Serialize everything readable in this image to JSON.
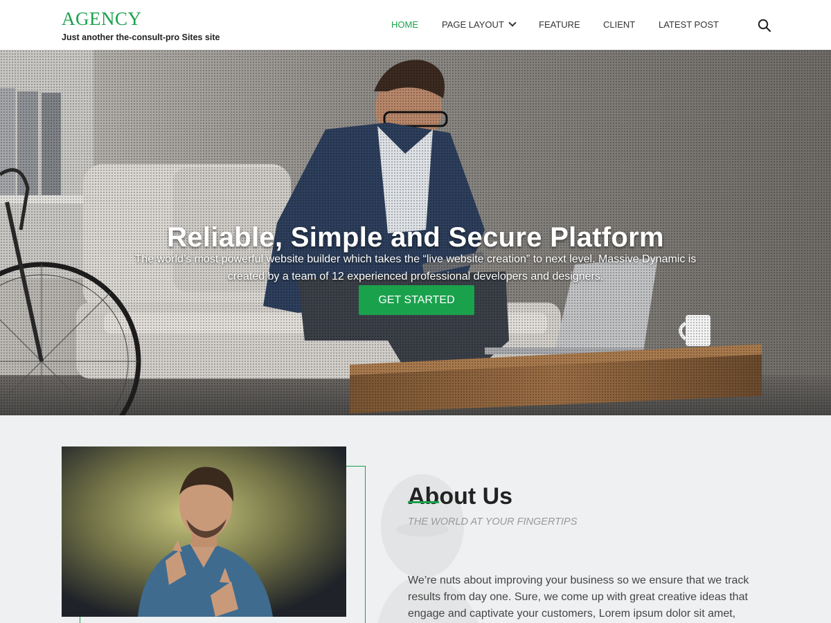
{
  "brand": {
    "title": "AGENCY",
    "tagline": "Just another the-consult-pro Sites site"
  },
  "nav": {
    "items": [
      {
        "label": "HOME",
        "active": true
      },
      {
        "label": "PAGE LAYOUT",
        "has_dropdown": true
      },
      {
        "label": "FEATURE"
      },
      {
        "label": "CLIENT"
      },
      {
        "label": "LATEST POST"
      }
    ],
    "search_icon": "search-icon"
  },
  "hero": {
    "title": "Reliable, Simple and Secure Platform",
    "text": "The world’s most powerful website builder which takes the “live website creation” to next level. Massive Dynamic is created by a team of 12 experienced professional developers and designers.",
    "button_label": "GET STARTED"
  },
  "about": {
    "heading": "About Us",
    "subtitle": "THE WORLD AT YOUR FINGERTIPS",
    "body": "We’re nuts about improving your business so we ensure that we track results from day one. Sure, we come up with great creative ideas that engage and captivate your customers, Lorem ipsum dolor sit amet, consectetur adipiscing elit. Sed varius quam ut magna ultricies"
  },
  "colors": {
    "accent": "#1aa14c",
    "text_dark": "#222222",
    "about_bg": "#eef0f1"
  }
}
